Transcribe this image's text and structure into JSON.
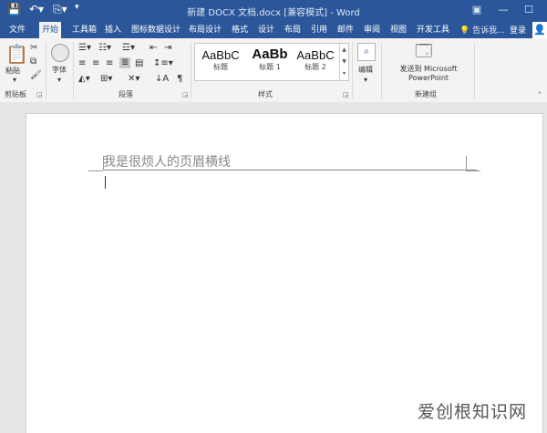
{
  "window": {
    "title": "新建 DOCX 文档.docx [兼容模式] - Word"
  },
  "tabs": [
    "文件",
    "开始",
    "工具箱",
    "插入",
    "图标数据设计",
    "布局设计",
    "格式",
    "设计",
    "布局",
    "引用",
    "邮件",
    "审阅",
    "视图",
    "开发工具"
  ],
  "tell_me": "告诉我...",
  "login": "登录",
  "ribbon": {
    "clipboard": {
      "paste": "粘贴",
      "label": "剪贴板"
    },
    "font": {
      "label": "字体"
    },
    "paragraph": {
      "label": "段落"
    },
    "styles": {
      "label": "样式",
      "items": [
        {
          "sample": "AaBbC",
          "name": "标题"
        },
        {
          "sample": "AaBb",
          "name": "标题 1"
        },
        {
          "sample": "AaBbC",
          "name": "标题 2"
        }
      ]
    },
    "editing": {
      "label": "编辑"
    },
    "new_group": {
      "button": "发送到 Microsoft PowerPoint",
      "label": "新建组"
    }
  },
  "document": {
    "header_text": "我是很烦人的页眉横线"
  },
  "watermark": "爱创根知识网"
}
